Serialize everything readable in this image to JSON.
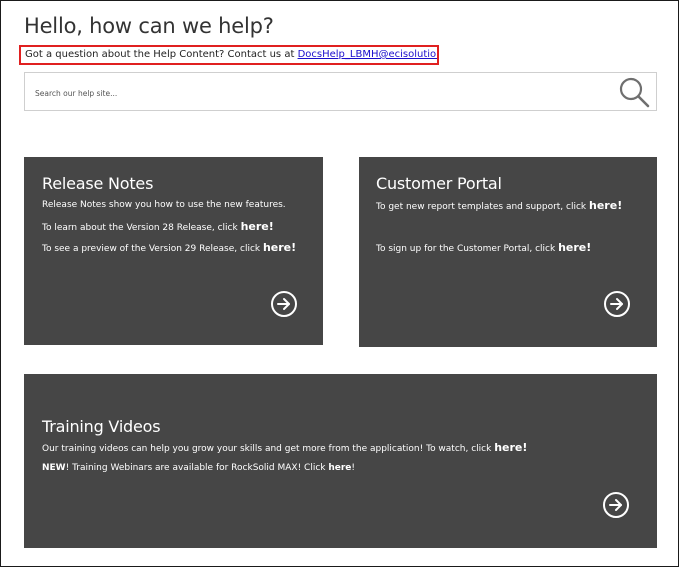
{
  "header": {
    "title": "Hello, how can we help?"
  },
  "contact": {
    "prefix": "Got a question about the Help Content? Contact us at ",
    "email": "DocsHelp_LBMH@ecisolutions.com",
    "suffix": "!"
  },
  "search": {
    "placeholder": "Search our help site..."
  },
  "cards": {
    "release_notes": {
      "title": "Release Notes",
      "line1": "Release Notes show you how to use the new features.",
      "line2_text": "To learn about the Version 28 Release, click ",
      "line2_link": "here!",
      "line3_text": "To see a preview of the Version 29 Release, click ",
      "line3_link": "here!"
    },
    "customer_portal": {
      "title": "Customer Portal",
      "line1_text": "To get new report templates and support, click ",
      "line1_link": "here!",
      "line2_text": "To sign up for the Customer Portal, click ",
      "line2_link": "here!"
    },
    "training_videos": {
      "title": "Training Videos",
      "line1_text": "Our training videos can help you grow your skills and get more from the application! To watch, click ",
      "line1_link": "here!",
      "line2_new": "NEW",
      "line2_text": "! Training Webinars are available for RockSolid MAX! Click ",
      "line2_link": "here",
      "line2_end": "!"
    }
  },
  "icons": {
    "search": "magnifier-icon",
    "arrow": "arrow-right-circle-icon"
  },
  "colors": {
    "card_bg": "#464646",
    "highlight_border": "#e02020",
    "link": "#1a0dcc"
  }
}
